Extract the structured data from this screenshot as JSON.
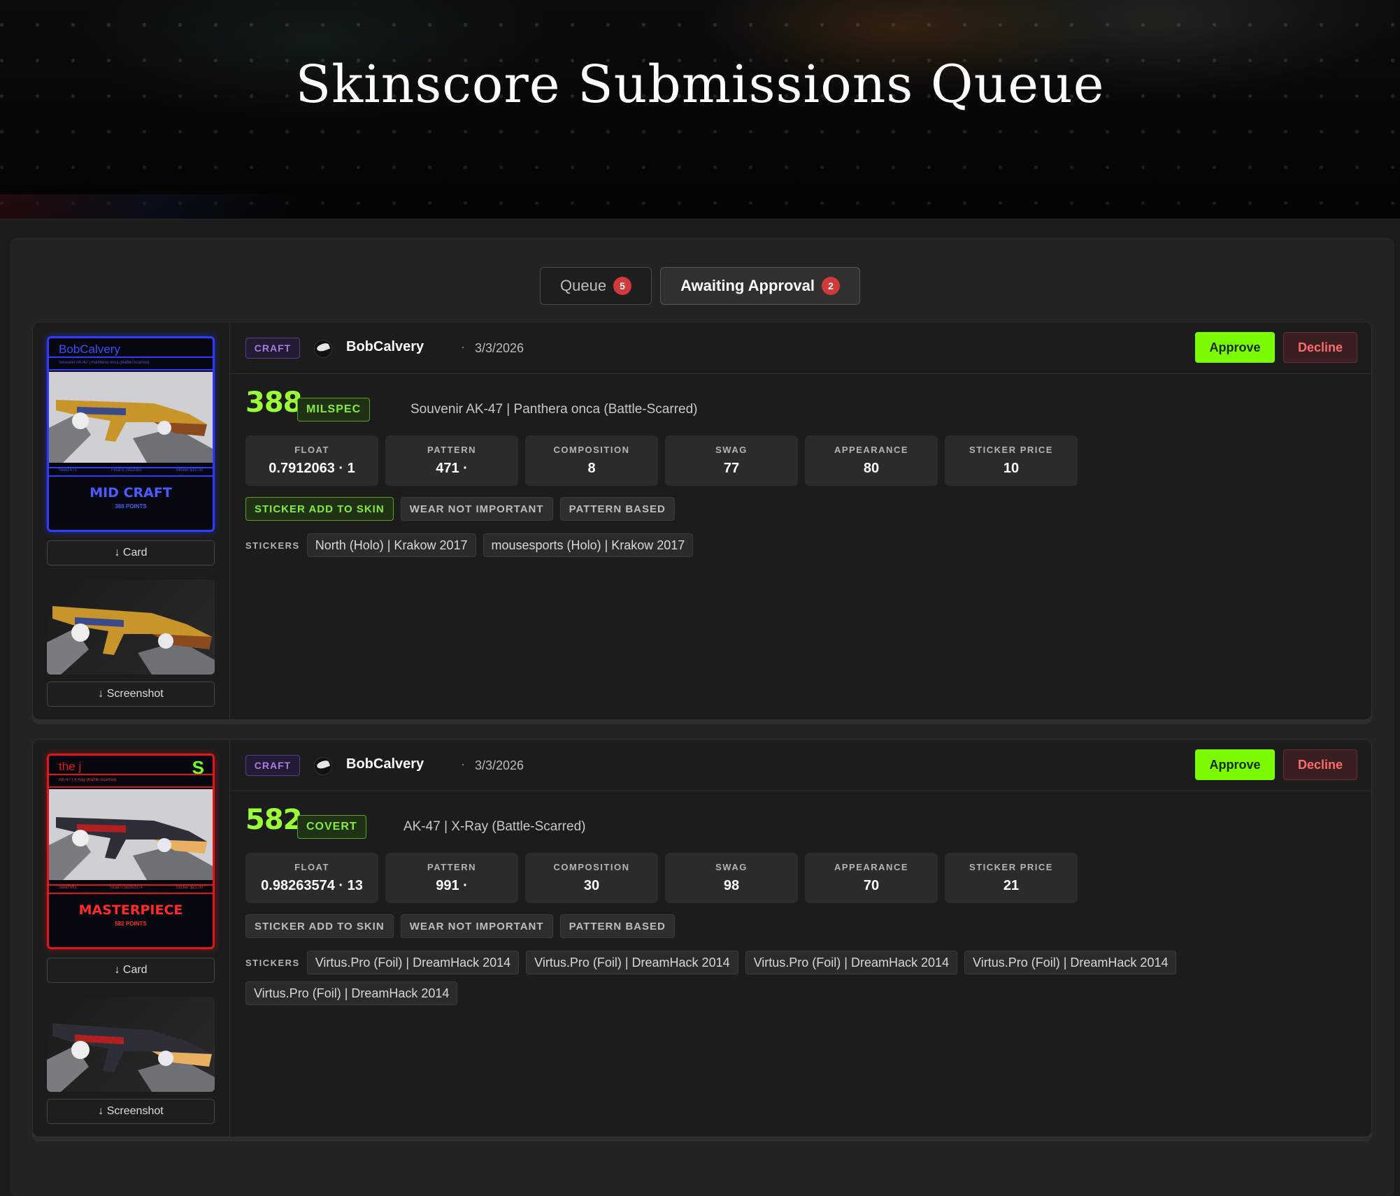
{
  "page": {
    "title": "Skinscore Submissions Queue"
  },
  "tabs": [
    {
      "label": "Queue",
      "count": "5",
      "active": false
    },
    {
      "label": "Awaiting Approval",
      "count": "2",
      "active": true
    }
  ],
  "submissions": [
    {
      "type": "CRAFT",
      "user": "BobCalvery",
      "date": "3/3/2026",
      "approve_label": "Approve",
      "decline_label": "Decline",
      "score": "388",
      "rarity": "MILSPEC",
      "skin_name": "Souvenir AK-47 | Panthera onca (Battle-Scarred)",
      "stats": [
        {
          "label": "FLOAT",
          "value": "0.7912063 · 1"
        },
        {
          "label": "PATTERN",
          "value": "471 ·"
        },
        {
          "label": "COMPOSITION",
          "value": "8"
        },
        {
          "label": "SWAG",
          "value": "77"
        },
        {
          "label": "APPEARANCE",
          "value": "80"
        },
        {
          "label": "STICKER PRICE",
          "value": "10"
        }
      ],
      "tags": [
        {
          "label": "STICKER ADD TO SKIN",
          "active": true
        },
        {
          "label": "WEAR NOT IMPORTANT",
          "active": false
        },
        {
          "label": "PATTERN BASED",
          "active": false
        }
      ],
      "stickers_label": "STICKERS",
      "stickers": [
        "North (Holo) | Krakow 2017",
        "mousesports (Holo) | Krakow 2017"
      ],
      "card": {
        "name": "BobCalvery",
        "subtitle": "Souvenir AK-47 | Panthera onca (Battle-Scarred)",
        "info": [
          "Seed 471",
          "Float 0.7912063",
          "Sticker $10.00"
        ],
        "tier": "MID CRAFT",
        "points": "388 POINTS",
        "accent": "#2f3bff"
      },
      "card_button": "↓ Card",
      "screenshot_button": "↓ Screenshot"
    },
    {
      "type": "CRAFT",
      "user": "BobCalvery",
      "date": "3/3/2026",
      "approve_label": "Approve",
      "decline_label": "Decline",
      "score": "582",
      "rarity": "COVERT",
      "skin_name": "AK-47 | X-Ray (Battle-Scarred)",
      "stats": [
        {
          "label": "FLOAT",
          "value": "0.98263574 · 13"
        },
        {
          "label": "PATTERN",
          "value": "991 ·"
        },
        {
          "label": "COMPOSITION",
          "value": "30"
        },
        {
          "label": "SWAG",
          "value": "98"
        },
        {
          "label": "APPEARANCE",
          "value": "70"
        },
        {
          "label": "STICKER PRICE",
          "value": "21"
        }
      ],
      "tags": [
        {
          "label": "STICKER ADD TO SKIN",
          "active": false
        },
        {
          "label": "WEAR NOT IMPORTANT",
          "active": false
        },
        {
          "label": "PATTERN BASED",
          "active": false
        }
      ],
      "stickers_label": "STICKERS",
      "stickers": [
        "Virtus.Pro (Foil) | DreamHack 2014",
        "Virtus.Pro (Foil) | DreamHack 2014",
        "Virtus.Pro (Foil) | DreamHack 2014",
        "Virtus.Pro (Foil) | DreamHack 2014",
        "Virtus.Pro (Foil) | DreamHack 2014"
      ],
      "card": {
        "name": "the j",
        "subtitle": "AK-47 | X-Ray (Battle-Scarred)",
        "info": [
          "Seed 991",
          "Float 0.98263574",
          "Sticker $21.00"
        ],
        "tier": "MASTERPIECE",
        "points": "582 POINTS",
        "accent": "#e0161b"
      },
      "card_button": "↓ Card",
      "screenshot_button": "↓ Screenshot"
    }
  ],
  "colors": {
    "score": "#9aff36",
    "approve": "#7cfc00",
    "decline": "#ff6b6b",
    "badge_count": "#d13a3a",
    "craft_badge": "#a77de6"
  }
}
